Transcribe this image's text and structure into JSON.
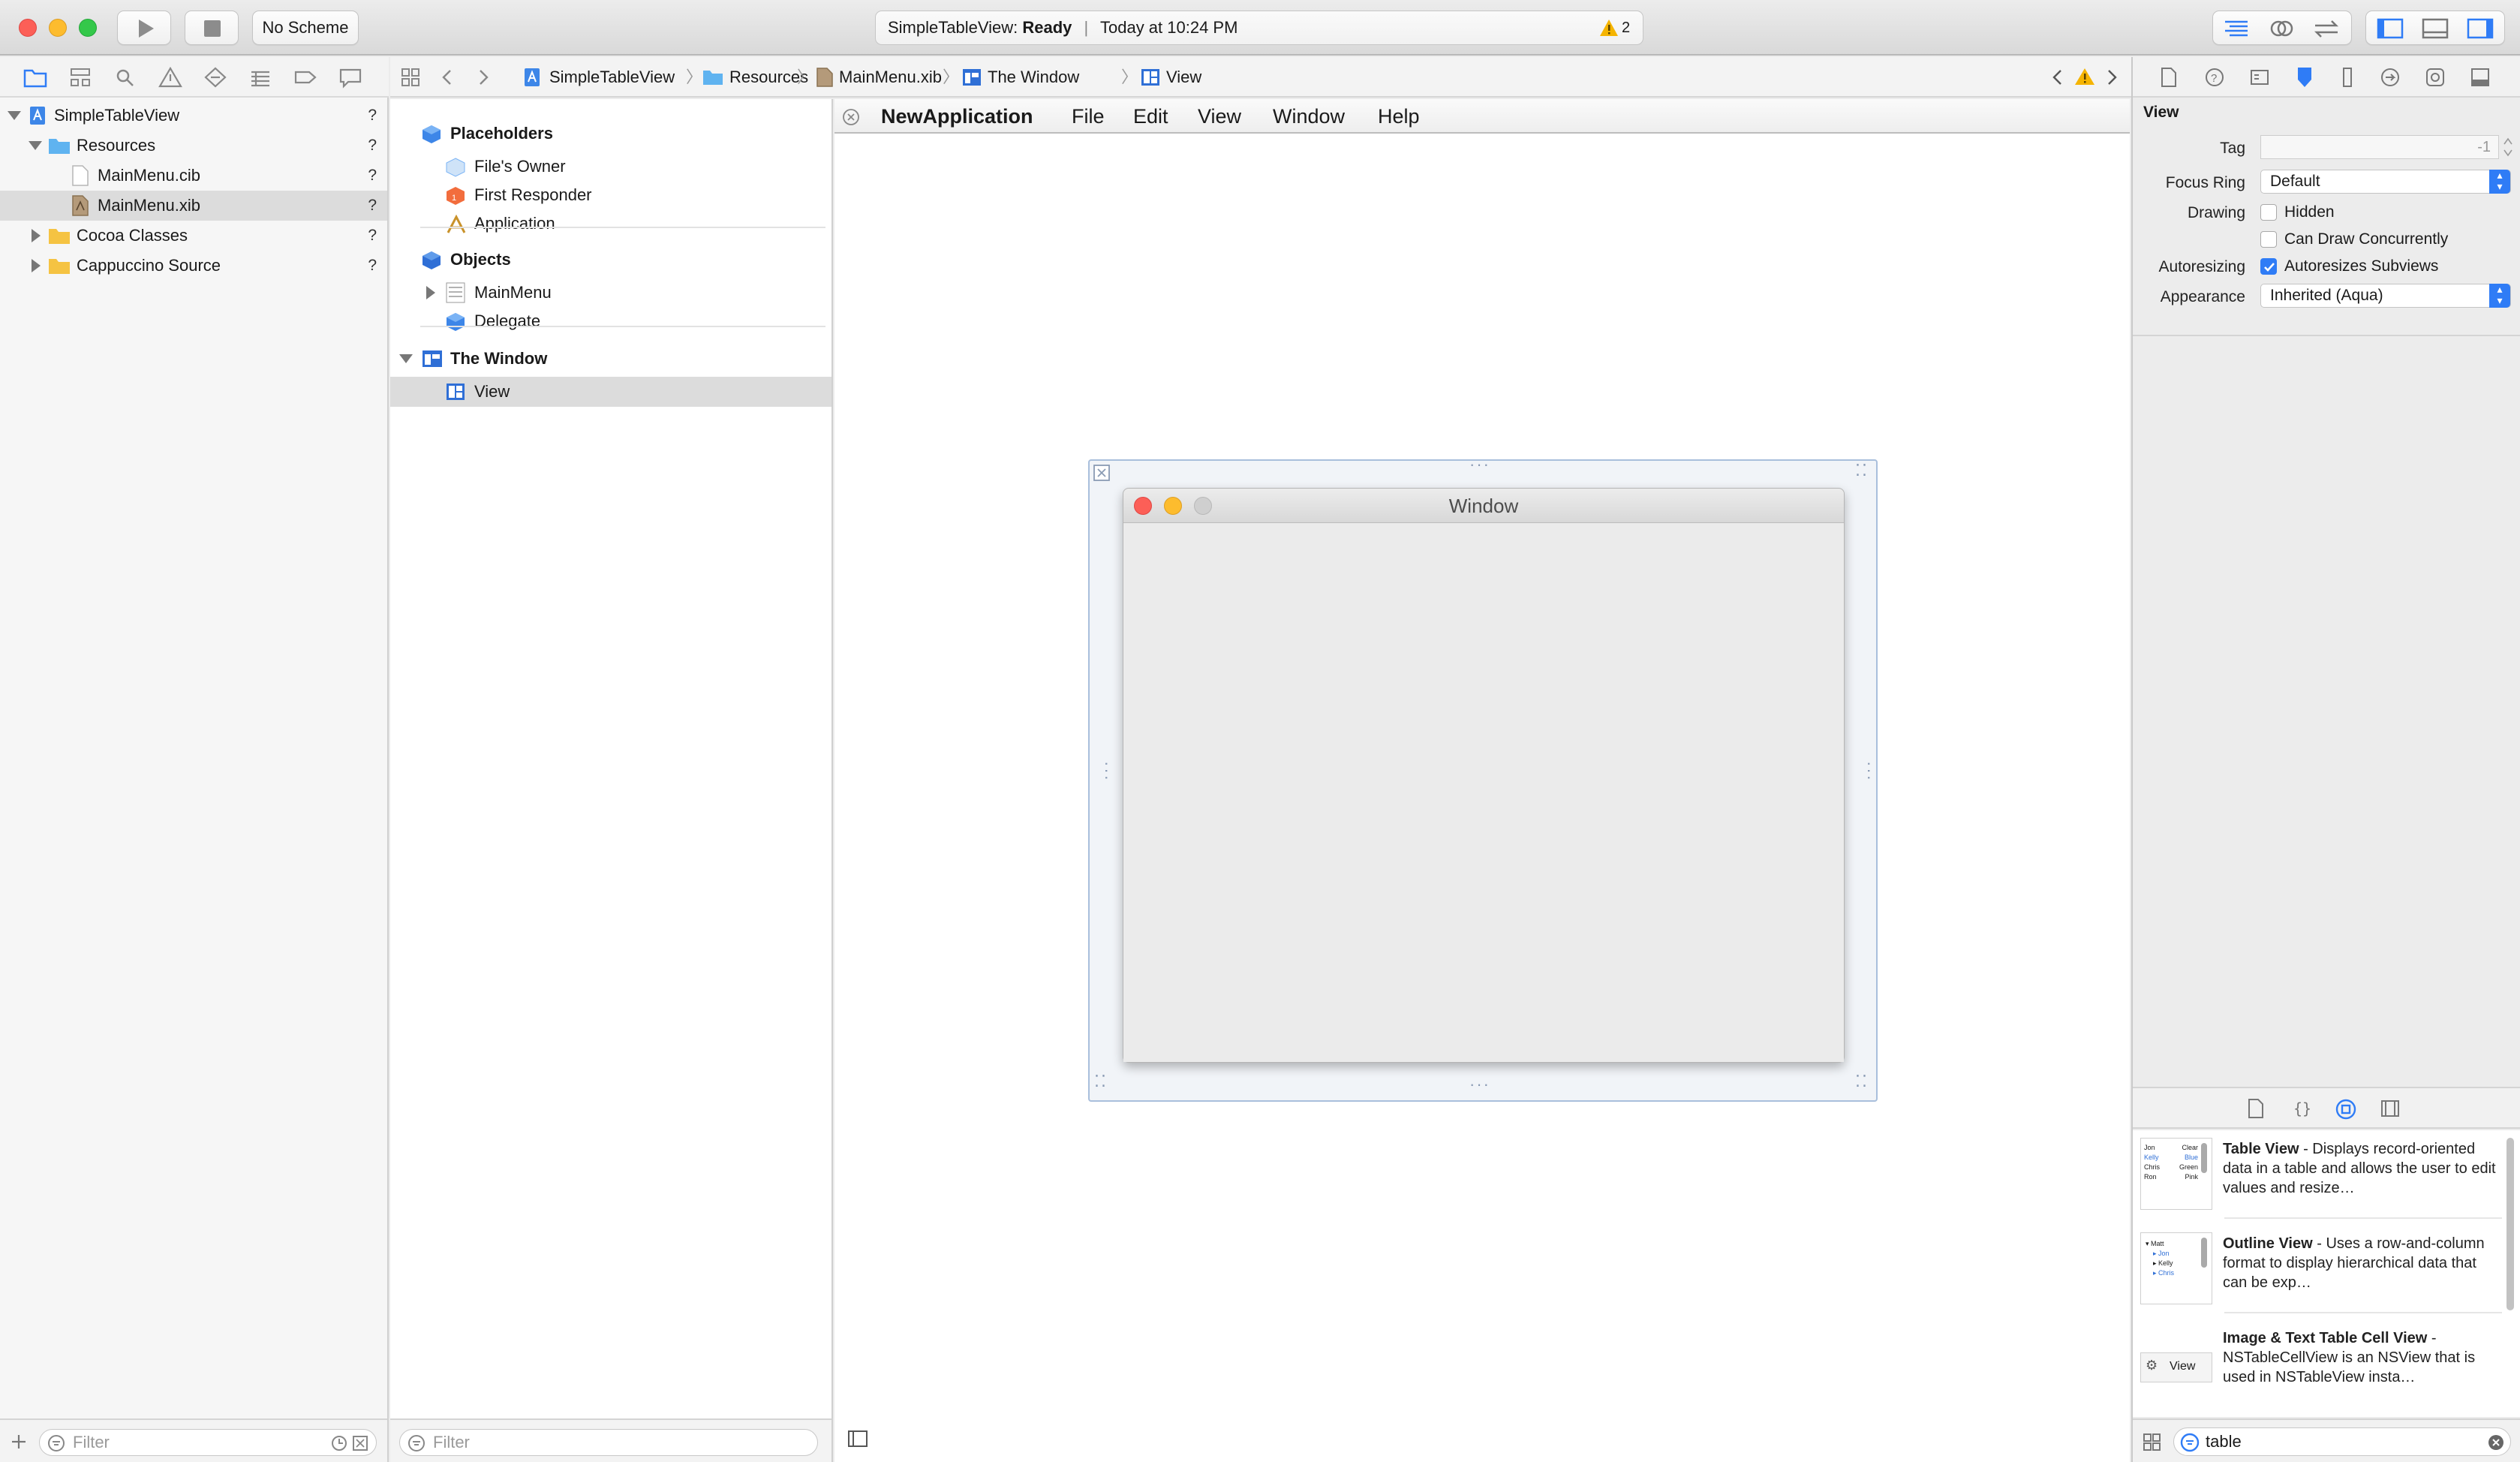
{
  "toolbar": {
    "scheme": "No Scheme",
    "status_project": "SimpleTableView:",
    "status_state": "Ready",
    "status_sep": "|",
    "status_time": "Today at 10:24 PM",
    "warning_count": "2"
  },
  "navigator": {
    "tree": [
      {
        "label": "SimpleTableView",
        "status": "?"
      },
      {
        "label": "Resources",
        "status": "?"
      },
      {
        "label": "MainMenu.cib",
        "status": "?"
      },
      {
        "label": "MainMenu.xib",
        "status": "?"
      },
      {
        "label": "Cocoa Classes",
        "status": "?"
      },
      {
        "label": "Cappuccino Source",
        "status": "?"
      }
    ],
    "filter_placeholder": "Filter"
  },
  "jumpbar": {
    "crumbs": [
      "SimpleTableView",
      "Resources",
      "MainMenu.xib",
      "The Window",
      "View"
    ]
  },
  "outline": {
    "sections": [
      {
        "title": "Placeholders",
        "items": [
          "File's Owner",
          "First Responder",
          "Application"
        ]
      },
      {
        "title": "Objects",
        "items": [
          "MainMenu",
          "Delegate"
        ]
      },
      {
        "title": "The Window",
        "items": [
          "View"
        ]
      }
    ],
    "filter_placeholder": "Filter"
  },
  "canvas": {
    "menubar": [
      "NewApplication",
      "File",
      "Edit",
      "View",
      "Window",
      "Help"
    ],
    "window_title": "Window"
  },
  "inspector": {
    "title": "View",
    "tag_label": "Tag",
    "tag_value": "-1",
    "focus_ring_label": "Focus Ring",
    "focus_ring_value": "Default",
    "drawing_label": "Drawing",
    "hidden_label": "Hidden",
    "hidden_checked": false,
    "concurrent_label": "Can Draw Concurrently",
    "concurrent_checked": false,
    "autoresizing_label": "Autoresizing",
    "autoresizes_label": "Autoresizes Subviews",
    "autoresizes_checked": true,
    "appearance_label": "Appearance",
    "appearance_value": "Inherited (Aqua)"
  },
  "library": {
    "items": [
      {
        "name": "Table View",
        "desc": " - Displays record-oriented data in a table and allows the user to edit values and resize…"
      },
      {
        "name": "Outline View",
        "desc": " - Uses a row-and-column format to display hierarchical data that can be exp…"
      },
      {
        "name": "Image & Text Table Cell View",
        "desc": " - NSTableCellView is an NSView that is used in NSTableView insta…"
      }
    ],
    "thumb_table": [
      "Jon",
      "Clear",
      "Kelly",
      "Blue",
      "Chris",
      "Green",
      "Ron",
      "Pink"
    ],
    "thumb_outline": [
      "Matt",
      "Jon",
      "Kelly",
      "Chris"
    ],
    "thumb_cell": "View",
    "search_value": "table"
  },
  "colors": {
    "accent": "#2f7cf6",
    "folder_blue": "#5fb3f0",
    "folder_yellow": "#f5c342",
    "warning": "#f5b400",
    "close": "#fc5f57",
    "minimize": "#fdbc2e",
    "zoom": "#34c84a"
  }
}
